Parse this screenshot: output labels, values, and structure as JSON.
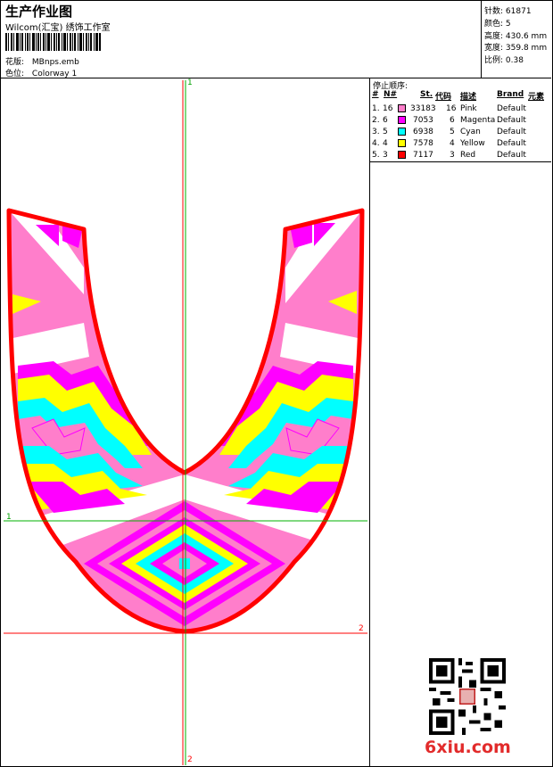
{
  "header": {
    "title": "生产作业图",
    "subtitle": "Wilcom(汇宝) 绣饰工作室",
    "pattern_label": "花版:",
    "pattern_value": "MBnps.emb",
    "colorway_label": "色位:",
    "colorway_value": "Colorway 1"
  },
  "stats": [
    {
      "label": "针数:",
      "value": "61871"
    },
    {
      "label": "颜色:",
      "value": "5"
    },
    {
      "label": "高度:",
      "value": "430.6 mm"
    },
    {
      "label": "宽度:",
      "value": "359.8 mm"
    },
    {
      "label": "比例:",
      "value": "0.38"
    }
  ],
  "stop_sequence": {
    "heading": "停止顺序:",
    "columns": [
      "#",
      "N#",
      "St.",
      "代码",
      "描述",
      "Brand",
      "元素"
    ],
    "rows": [
      {
        "index": "1.",
        "needle": "16",
        "stitches": "33183",
        "code": "16",
        "desc": "Pink",
        "brand": "Default",
        "color": "#ff7ecb"
      },
      {
        "index": "2.",
        "needle": "6",
        "stitches": "7053",
        "code": "6",
        "desc": "Magenta",
        "brand": "Default",
        "color": "#ff00ff"
      },
      {
        "index": "3.",
        "needle": "5",
        "stitches": "6938",
        "code": "5",
        "desc": "Cyan",
        "brand": "Default",
        "color": "#00ffff"
      },
      {
        "index": "4.",
        "needle": "4",
        "stitches": "7578",
        "code": "4",
        "desc": "Yellow",
        "brand": "Default",
        "color": "#ffff00"
      },
      {
        "index": "5.",
        "needle": "3",
        "stitches": "7117",
        "code": "3",
        "desc": "Red",
        "brand": "Default",
        "color": "#ff0000"
      }
    ]
  },
  "guides": {
    "vertical_top": "1",
    "vertical_bottom": "2",
    "horizontal_green": "1",
    "horizontal_red": "2"
  },
  "colors": {
    "pink": "#ff7ecb",
    "magenta": "#ff00ff",
    "cyan": "#00ffff",
    "yellow": "#ffff00",
    "red": "#ff0000",
    "green_guide": "#00b000",
    "red_guide": "#ff0000"
  },
  "watermark": "6xiu.com"
}
